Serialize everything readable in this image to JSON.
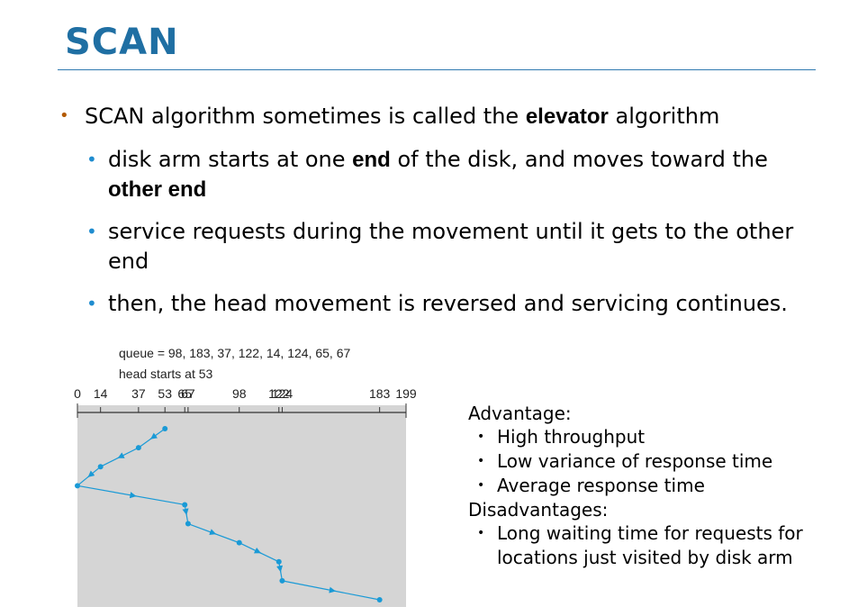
{
  "slide": {
    "title": "SCAN",
    "bullets": [
      {
        "parts": [
          {
            "text": "SCAN algorithm sometimes is called the ",
            "bold": false
          },
          {
            "text": "elevator",
            "bold": true
          },
          {
            "text": " algorithm",
            "bold": false
          }
        ]
      }
    ],
    "sub_bullets": [
      {
        "parts": [
          {
            "text": "disk arm starts at one ",
            "bold": false
          },
          {
            "text": "end",
            "bold": true
          },
          {
            "text": " of the disk, and moves toward the ",
            "bold": false
          },
          {
            "text": "other end",
            "bold": true
          }
        ]
      },
      {
        "parts": [
          {
            "text": "service requests during the movement until it gets to the other end",
            "bold": false
          }
        ]
      },
      {
        "parts": [
          {
            "text": "then, the head movement is reversed and servicing continues.",
            "bold": false
          }
        ]
      }
    ]
  },
  "diagram": {
    "queue_text": "queue = 98, 183, 37, 122, 14, 124, 65, 67",
    "head_text": "head starts at 53",
    "ticks": [
      0,
      14,
      37,
      53,
      65,
      67,
      98,
      122,
      124,
      183,
      199
    ],
    "tick_labels": [
      {
        "text": "0",
        "v": 0
      },
      {
        "text": "14",
        "v": 14
      },
      {
        "text": "37",
        "v": 37
      },
      {
        "text": "53",
        "v": 53
      },
      {
        "text": "65",
        "v": 65
      },
      {
        "text": "67",
        "v": 67
      },
      {
        "text": "98",
        "v": 98
      },
      {
        "text": "122",
        "v": 122
      },
      {
        "text": "124",
        "v": 124
      },
      {
        "text": "183",
        "v": 183
      },
      {
        "text": "199",
        "v": 199
      }
    ],
    "path": [
      53,
      37,
      14,
      0,
      65,
      67,
      98,
      122,
      124,
      183
    ],
    "max_cylinder": 199,
    "colors": {
      "panel": "#d5d5d5",
      "line": "#1a9ad6",
      "axis": "#333333"
    }
  },
  "sidebar": {
    "advantage_title": "Advantage:",
    "advantages": [
      "High throughput",
      "Low variance of response time",
      "Average response time"
    ],
    "disadvantage_title": "Disadvantages:",
    "disadvantages": [
      "Long waiting time for requests for locations just visited by disk arm"
    ]
  }
}
